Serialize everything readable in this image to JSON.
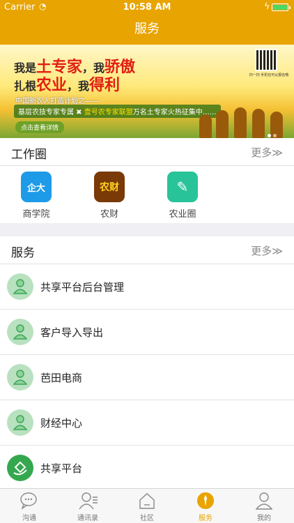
{
  "status": {
    "carrier": "Carrier",
    "time": "10:58 AM",
    "battery_level": 1.0
  },
  "header": {
    "title": "服务"
  },
  "banner": {
    "line1_a": "我是",
    "line1_b": "土专家",
    "line1_c": "，我",
    "line1_d": "骄傲",
    "line2_a": "扎根",
    "line2_b": "农业",
    "line2_c": "，我",
    "line2_d": "得利",
    "line3": "中国新农人打造计划之——",
    "line4_a": "基层农技专家专属",
    "line4_b": "壹号农专家联盟",
    "line4_c": "万名土专家火热征集中……",
    "cta": "点击查看详情",
    "qr_caption": "扫一扫 手机也可以报名哦"
  },
  "work_circle": {
    "title": "工作圈",
    "more": "更多≫",
    "items": [
      {
        "label": "商学院",
        "icon": "business-school-icon",
        "color": "#1e9be8",
        "glyph": "企大"
      },
      {
        "label": "农财",
        "icon": "nongcai-icon",
        "color": "#7a3a08",
        "glyph": "农财"
      },
      {
        "label": "农业圈",
        "icon": "note-edit-icon",
        "color": "#29c39a",
        "glyph": "✎"
      }
    ]
  },
  "services": {
    "title": "服务",
    "more": "更多≫",
    "items": [
      {
        "label": "共享平台后台管理",
        "icon": "user-avatar-icon"
      },
      {
        "label": "客户导入导出",
        "icon": "user-avatar-icon"
      },
      {
        "label": "芭田电商",
        "icon": "user-avatar-icon"
      },
      {
        "label": "财经中心",
        "icon": "user-avatar-icon"
      },
      {
        "label": "共享平台",
        "icon": "share-platform-icon"
      }
    ]
  },
  "tabs": [
    {
      "label": "沟通",
      "icon": "chat-icon",
      "active": false
    },
    {
      "label": "通讯录",
      "icon": "contacts-icon",
      "active": false
    },
    {
      "label": "社区",
      "icon": "community-icon",
      "active": false
    },
    {
      "label": "服务",
      "icon": "service-icon",
      "active": true
    },
    {
      "label": "我的",
      "icon": "profile-icon",
      "active": false
    }
  ],
  "colors": {
    "accent": "#e8a400",
    "avatar_bg": "#b9e1c0",
    "avatar_fg": "#3aa855"
  }
}
